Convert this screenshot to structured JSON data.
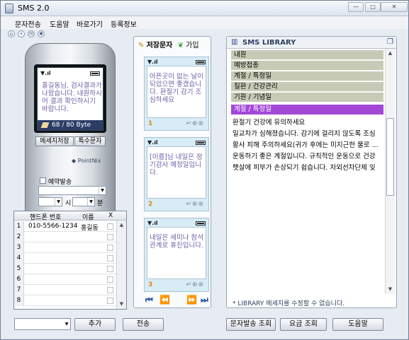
{
  "window": {
    "title": "SMS 2.0"
  },
  "menu": [
    "문자전송",
    "도움말",
    "바로가기",
    "등록정보"
  ],
  "phone": {
    "message": "홍길동님. 검사결과가 나왔습니다. 내원하시어 결과 확인하시기 바랍니다.",
    "byte_counter": "68 / 80 Byte",
    "brand": "PointNix",
    "save_button": "메세지저장",
    "special_button": "특수문자",
    "reserve_label": "예약발송",
    "hour_label": "시",
    "minute_label": "분"
  },
  "recipients": {
    "columns": [
      "핸드폰 번호",
      "이름",
      "X"
    ],
    "rows": [
      {
        "num": "1",
        "phone": "010-5566-1234",
        "name": "홍길동"
      },
      {
        "num": "2",
        "phone": "",
        "name": ""
      },
      {
        "num": "3",
        "phone": "",
        "name": ""
      },
      {
        "num": "4",
        "phone": "",
        "name": ""
      },
      {
        "num": "5",
        "phone": "",
        "name": ""
      },
      {
        "num": "6",
        "phone": "",
        "name": ""
      },
      {
        "num": "7",
        "phone": "",
        "name": ""
      },
      {
        "num": "8",
        "phone": "",
        "name": ""
      }
    ]
  },
  "saved": {
    "tab_saved": "저장문자",
    "tab_join": "가입",
    "messages": [
      {
        "num": "1",
        "text": "아픈곳이 없는 날이 되었으면 좋겠습니다. 환절기 감기 조심하세요"
      },
      {
        "num": "2",
        "text": "[이름]님 내일은 정기검사 예정일입니다."
      },
      {
        "num": "3",
        "text": "내일은 세미나 참석관계로 휴진입니다."
      }
    ]
  },
  "library": {
    "title": "SMS LIBRARY",
    "categories": [
      "내원",
      "예방접종",
      "계절 / 특정일",
      "질환 / 건강관리",
      "기원 / 기념일"
    ],
    "selected": "계절 / 특정일",
    "lines": [
      "환절기 건강에 유의하세요",
      "일교차가 심해졌습니다. 감기에 걸리지 않도록 조심",
      "황사 피해 주의하세요(귀가 후에는 미지근한 물로 ...",
      "운동하기 좋은 계절입니다. 규칙적인 운동으로 건강",
      "햇살에 피부가 손상되기 쉽습니다. 자외선차단제 잊"
    ],
    "note": "* LIBRARY 메세지를 수정할 수 없습니다."
  },
  "bottom": {
    "add": "추가",
    "send": "전송",
    "sent_history": "문자발송 조회",
    "fee": "요금 조회",
    "help": "도움말"
  }
}
